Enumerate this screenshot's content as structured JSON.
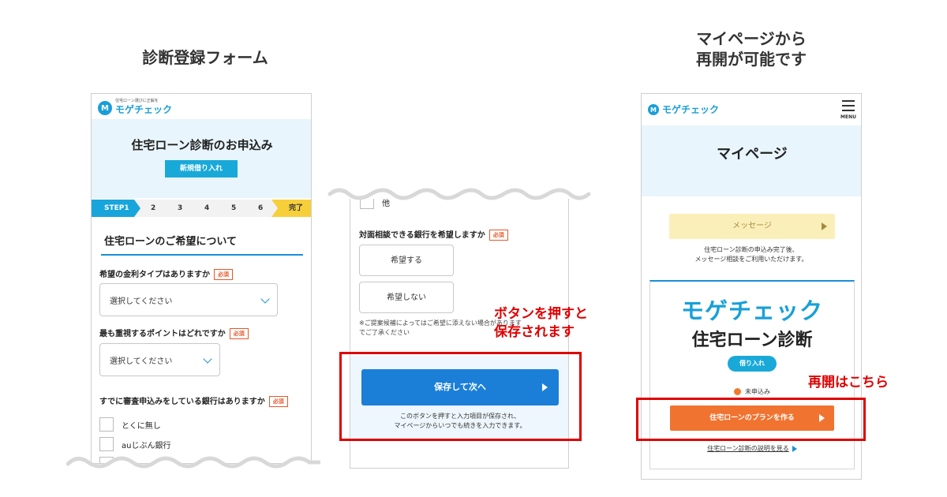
{
  "headings": {
    "form": "診断登録フォーム",
    "mypage_line1": "マイページから",
    "mypage_line2": "再開が可能です"
  },
  "brand": {
    "tagline": "住宅ローン選びに正解を",
    "name": "モゲチェック",
    "accent": "#1a9ed8"
  },
  "panel1": {
    "title": "住宅ローン診断のお申込み",
    "loan_type_button": "新規借り入れ",
    "steps": [
      "STEP1",
      "2",
      "3",
      "4",
      "5",
      "6",
      "完了"
    ],
    "section_title": "住宅ローンのご希望について",
    "required_badge": "必須",
    "q1": "希望の金利タイプはありますか",
    "q1_select": "選択してください",
    "q2": "最も重視するポイントはどれですか",
    "q2_select": "選択してください",
    "q3": "すでに審査申込みをしている銀行はありますか",
    "checkbox_options": [
      "とくに無し",
      "auじぶん銀行"
    ]
  },
  "panel2": {
    "partial_label": "他",
    "question": "対面相談できる銀行を希望しますか",
    "required_badge": "必須",
    "option_yes": "希望する",
    "option_no": "希望しない",
    "note_line1": "※ご提案候補によってはご希望に添えない場合があります",
    "note_line2": "でご了承ください",
    "save_button": "保存して次へ",
    "save_note_line1": "このボタンを押すと入力項目が保存され、",
    "save_note_line2": "マイページからいつでも続きを入力できます。",
    "annotation_line1": "ボタンを押すと",
    "annotation_line2": "保存されます"
  },
  "panel3": {
    "menu_label": "MENU",
    "title": "マイページ",
    "message_button": "メッセージ",
    "message_note_line1": "住宅ローン診断の申込み完了後、",
    "message_note_line2": "メッセージ相談をご利用いただけます。",
    "brand_large": "モゲチェック",
    "product": "住宅ローン診断",
    "loan_type_pill": "借り入れ",
    "status": "未申込み",
    "cta_button": "住宅ローンのプランを作る",
    "explain_link": "住宅ローン診断の説明を見る",
    "annotation": "再開はこちら"
  },
  "colors": {
    "accent_blue": "#1b7fd8",
    "cta_orange": "#f07330",
    "annotation_red": "#e00000",
    "step_done_yellow": "#f7cf3a"
  }
}
